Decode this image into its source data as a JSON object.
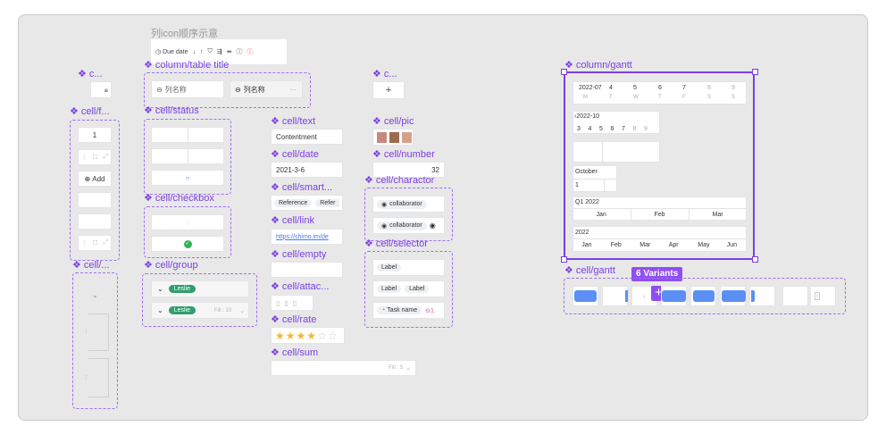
{
  "header": {
    "title": "列icon顺序示意"
  },
  "toolbar": {
    "due_date": "Due date"
  },
  "labels": {
    "c_top1": "c...",
    "cell_f": "cell/f...",
    "cell_dots": "cell/...",
    "column_table_title": "column/table title",
    "cell_status": "cell/status",
    "cell_checkbox": "cell/checkbox",
    "cell_group": "cell/group",
    "cell_text": "cell/text",
    "cell_date": "cell/date",
    "cell_smart": "cell/smart...",
    "cell_link": "cell/link",
    "cell_empty": "cell/empty",
    "cell_attach": "cell/attac...",
    "cell_rate": "cell/rate",
    "cell_sum": "cell/sum",
    "c_top2": "c...",
    "cell_pic": "cell/pic",
    "cell_number": "cell/number",
    "cell_charactor": "cell/charactor",
    "cell_selector": "cell/selector",
    "column_gantt": "column/gantt",
    "cell_gantt": "cell/gantt"
  },
  "column_title": {
    "col1": "列名称",
    "col2": "列名称",
    "more": "···"
  },
  "cells": {
    "num": "1",
    "add": "Add",
    "text": "Contentment",
    "date": "2021-3-6",
    "smart1": "Reference",
    "smart2": "Refer",
    "link": "https://shimo.im/de",
    "number": "32",
    "collab": "collaborator",
    "label": "Label",
    "task": "Task name",
    "task_count": "1",
    "group_name": "Leslie",
    "fill_group": "Fill : 10",
    "fill_sum": "Fill : 5",
    "stars_filled": 4,
    "stars_total": 6
  },
  "gantt": {
    "row1": {
      "month": "2022-07",
      "days": [
        "4",
        "5",
        "6",
        "7",
        "8",
        "9"
      ],
      "dows": [
        "M",
        "T",
        "W",
        "T",
        "F",
        "S",
        "S"
      ]
    },
    "row2": {
      "month": "2022-10",
      "days": [
        "3",
        "4",
        "5",
        "6",
        "7",
        "8",
        "9"
      ]
    },
    "row4": {
      "month": "October",
      "day": "1"
    },
    "row5": {
      "quarter": "Q1 2022",
      "months": [
        "Jan",
        "Feb",
        "Mar"
      ]
    },
    "row6": {
      "year": "2022",
      "months": [
        "Jan",
        "Feb",
        "Mar",
        "Apr",
        "May",
        "Jun"
      ]
    }
  },
  "variants": {
    "label": "6 Variants"
  },
  "colors": {
    "accent": "#7b3fe4",
    "bar": "#5b8ff5",
    "green": "#2f9e6d",
    "badge": "#8f4ef3"
  }
}
